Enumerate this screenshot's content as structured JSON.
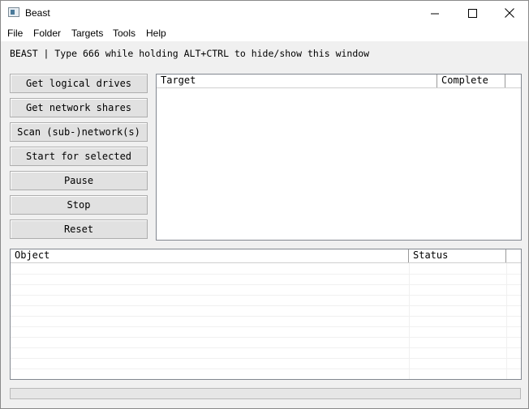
{
  "window": {
    "title": "Beast",
    "controls": {
      "minimize": "—",
      "maximize": "☐",
      "close": "✕"
    }
  },
  "menu": [
    "File",
    "Folder",
    "Targets",
    "Tools",
    "Help"
  ],
  "info_line": "BEAST | Type 666 while holding ALT+CTRL to hide/show this window",
  "buttons": [
    "Get logical drives",
    "Get network shares",
    "Scan (sub-)network(s)",
    "Start for selected",
    "Pause",
    "Stop",
    "Reset"
  ],
  "targets_list": {
    "columns": [
      "Target",
      "Complete",
      ""
    ],
    "rows": []
  },
  "objects_list": {
    "columns": [
      "Object",
      "Status",
      ""
    ],
    "rows": []
  },
  "status_bar": {
    "text": ""
  },
  "colors": {
    "window_bg": "#f0f0f0",
    "button_bg": "#e1e1e1",
    "list_bg": "#ffffff"
  }
}
